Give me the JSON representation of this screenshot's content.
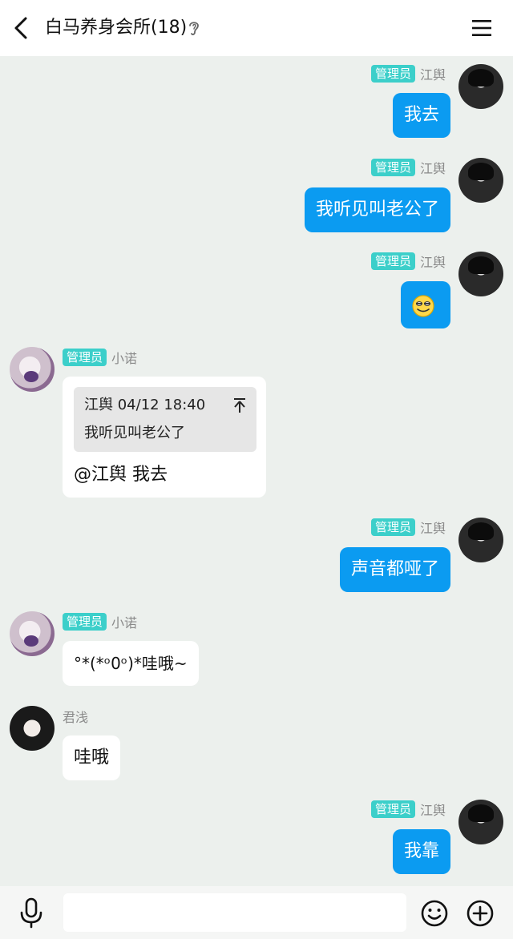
{
  "header": {
    "title": "白马养身会所(18)"
  },
  "badge_label": "管理员",
  "messages": [
    {
      "sender": "江舆",
      "text": "我去"
    },
    {
      "sender": "江舆",
      "text": "我听见叫老公了"
    },
    {
      "sender": "江舆",
      "emoji": "smirk-emoji"
    },
    {
      "sender": "小诺",
      "quote_header": "江舆 04/12 18:40",
      "quote_text": "我听见叫老公了",
      "text": "@江舆 我去"
    },
    {
      "sender": "江舆",
      "text": "声音都哑了"
    },
    {
      "sender": "小诺",
      "text": "°*(*ᵒ0ᵒ)*哇哦~"
    },
    {
      "sender": "君浅",
      "text": "哇哦"
    },
    {
      "sender": "江舆",
      "text": "我靠"
    }
  ],
  "colors": {
    "accent": "#0b9bf1",
    "badge": "#3ccfca",
    "background": "#ecf0ed"
  }
}
